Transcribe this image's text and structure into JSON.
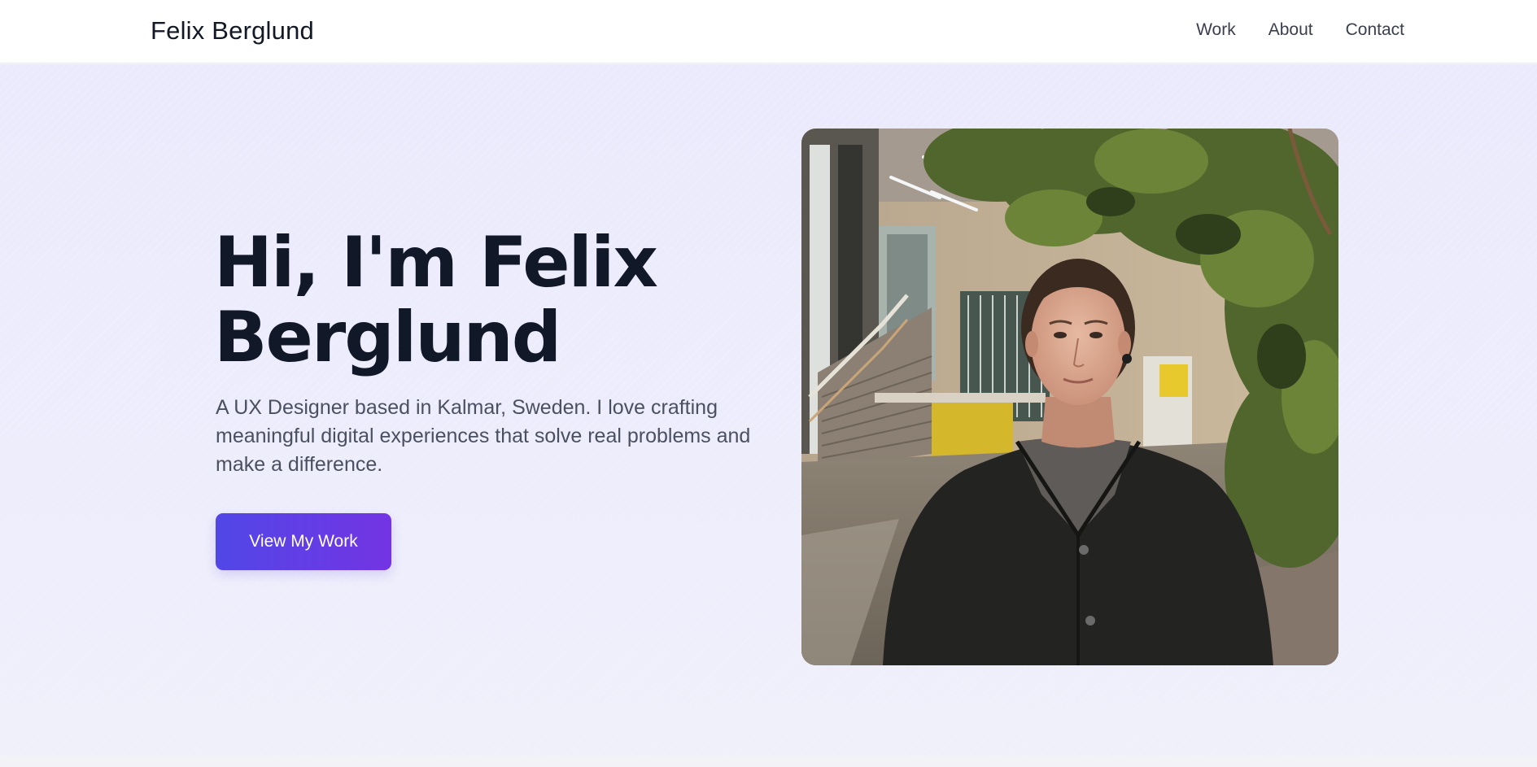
{
  "header": {
    "brand": "Felix Berglund",
    "nav": [
      "Work",
      "About",
      "Contact"
    ]
  },
  "hero": {
    "title_line1": "Hi, I'm Felix",
    "title_line2": "Berglund",
    "description": "A UX Designer based in Kalmar, Sweden. I love crafting meaningful digital experiences that solve real problems and make a difference.",
    "cta_label": "View My Work",
    "portrait_alt": "Portrait of Felix Berglund"
  },
  "colors": {
    "accent_start": "#5147e6",
    "accent_end": "#7334e4",
    "heading": "#111827",
    "body_text": "#4b5060",
    "hero_background": "#ececfc"
  }
}
